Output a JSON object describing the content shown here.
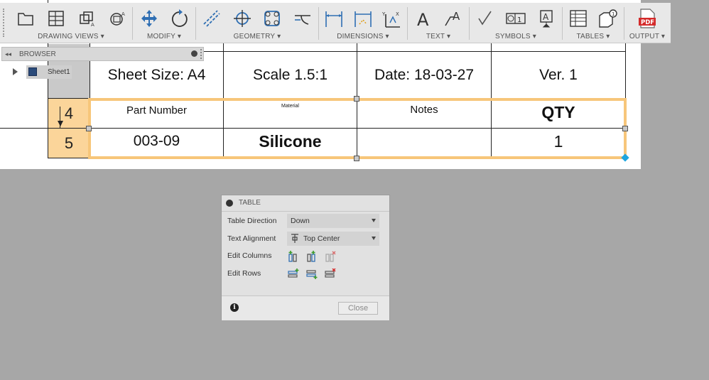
{
  "toolbar": {
    "groups": [
      {
        "label": "DRAWING VIEWS ▾"
      },
      {
        "label": "MODIFY ▾"
      },
      {
        "label": "GEOMETRY ▾"
      },
      {
        "label": "DIMENSIONS ▾"
      },
      {
        "label": "TEXT ▾"
      },
      {
        "label": "SYMBOLS ▾"
      },
      {
        "label": "TABLES ▾"
      },
      {
        "label": "OUTPUT ▾"
      }
    ],
    "pdf_label": "PDF"
  },
  "browser": {
    "title": "BROWSER",
    "items": [
      {
        "label": "Sheet1"
      }
    ]
  },
  "drawing_table": {
    "header_row": {
      "sheet_size": "Sheet Size: A4",
      "scale": "Scale 1.5:1",
      "date": "Date: 18-03-27",
      "version": "Ver. 1"
    },
    "rows": [
      {
        "num": "4",
        "cells": [
          "Part Number",
          "Material",
          "Notes",
          "QTY"
        ]
      },
      {
        "num": "5",
        "cells": [
          "003-09",
          "Silicone",
          "",
          "1"
        ]
      }
    ],
    "selection_color": "#f7c67a"
  },
  "dialog": {
    "title": "TABLE",
    "fields": {
      "direction_label": "Table Direction",
      "direction_value": "Down",
      "alignment_label": "Text Alignment",
      "alignment_value": "Top Center",
      "columns_label": "Edit Columns",
      "rows_label": "Edit Rows"
    },
    "close_label": "Close"
  }
}
